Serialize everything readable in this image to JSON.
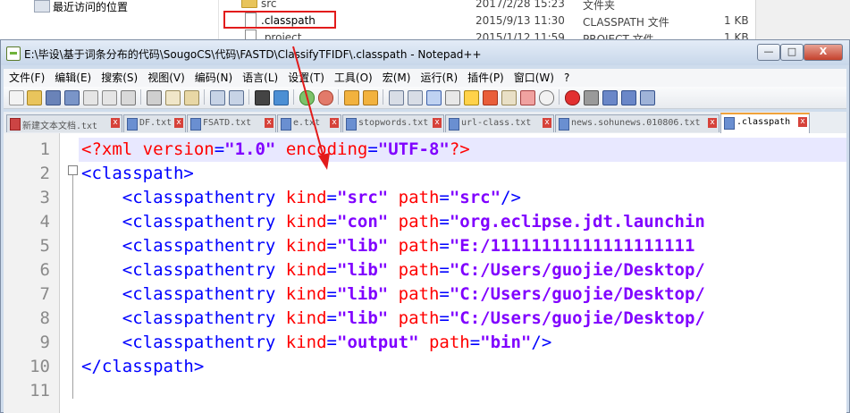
{
  "explorer": {
    "nav_item": "最近访问的位置",
    "rows": [
      {
        "name": "src",
        "date": "2017/2/28 15:23",
        "type": "文件夹",
        "size": ""
      },
      {
        "name": ".classpath",
        "date": "2015/9/13 11:30",
        "type": "CLASSPATH 文件",
        "size": "1 KB"
      },
      {
        "name": ".project",
        "date": "2015/1/12 11:59",
        "type": "PROJECT 文件",
        "size": "1 KB"
      }
    ]
  },
  "window": {
    "title": "E:\\毕设\\基于词条分布的代码\\SougoCS\\代码\\FASTD\\ClassifyTFIDF\\.classpath - Notepad++",
    "btn_min": "—",
    "btn_max": "□",
    "btn_close": "X"
  },
  "menu": [
    "文件(F)",
    "编辑(E)",
    "搜索(S)",
    "视图(V)",
    "编码(N)",
    "语言(L)",
    "设置(T)",
    "工具(O)",
    "宏(M)",
    "运行(R)",
    "插件(P)",
    "窗口(W)",
    "?"
  ],
  "tabs": [
    {
      "label": "新建文本文档.txt"
    },
    {
      "label": "DF.txt"
    },
    {
      "label": "FSATD.txt"
    },
    {
      "label": "e.txt"
    },
    {
      "label": "stopwords.txt"
    },
    {
      "label": "url-class.txt"
    },
    {
      "label": "news.sohunews.010806.txt"
    },
    {
      "label": ".classpath"
    }
  ],
  "editor": {
    "lines": [
      {
        "n": "1",
        "parts": [
          [
            "pi",
            "<?xml "
          ],
          [
            "attr",
            "version"
          ],
          [
            "tag",
            "="
          ],
          [
            "val",
            "\"1.0\""
          ],
          [
            "attr",
            " encoding"
          ],
          [
            "tag",
            "="
          ],
          [
            "val",
            "\"UTF-8\""
          ],
          [
            "pi",
            "?>"
          ]
        ]
      },
      {
        "n": "2",
        "parts": [
          [
            "tag",
            "<classpath>"
          ]
        ]
      },
      {
        "n": "3",
        "parts": [
          [
            "tag",
            "    <classpathentry "
          ],
          [
            "attr",
            "kind"
          ],
          [
            "tag",
            "="
          ],
          [
            "val",
            "\"src\""
          ],
          [
            "attr",
            " path"
          ],
          [
            "tag",
            "="
          ],
          [
            "val",
            "\"src\""
          ],
          [
            "tag",
            "/>"
          ]
        ]
      },
      {
        "n": "4",
        "parts": [
          [
            "tag",
            "    <classpathentry "
          ],
          [
            "attr",
            "kind"
          ],
          [
            "tag",
            "="
          ],
          [
            "val",
            "\"con\""
          ],
          [
            "attr",
            " path"
          ],
          [
            "tag",
            "="
          ],
          [
            "val",
            "\"org.eclipse.jdt.launchin"
          ]
        ]
      },
      {
        "n": "5",
        "parts": [
          [
            "tag",
            "    <classpathentry "
          ],
          [
            "attr",
            "kind"
          ],
          [
            "tag",
            "="
          ],
          [
            "val",
            "\"lib\""
          ],
          [
            "attr",
            " path"
          ],
          [
            "tag",
            "="
          ],
          [
            "val",
            "\"E:/11111111111111111111"
          ]
        ]
      },
      {
        "n": "6",
        "parts": [
          [
            "tag",
            "    <classpathentry "
          ],
          [
            "attr",
            "kind"
          ],
          [
            "tag",
            "="
          ],
          [
            "val",
            "\"lib\""
          ],
          [
            "attr",
            " path"
          ],
          [
            "tag",
            "="
          ],
          [
            "val",
            "\"C:/Users/guojie/Desktop/"
          ]
        ]
      },
      {
        "n": "7",
        "parts": [
          [
            "tag",
            "    <classpathentry "
          ],
          [
            "attr",
            "kind"
          ],
          [
            "tag",
            "="
          ],
          [
            "val",
            "\"lib\""
          ],
          [
            "attr",
            " path"
          ],
          [
            "tag",
            "="
          ],
          [
            "val",
            "\"C:/Users/guojie/Desktop/"
          ]
        ]
      },
      {
        "n": "8",
        "parts": [
          [
            "tag",
            "    <classpathentry "
          ],
          [
            "attr",
            "kind"
          ],
          [
            "tag",
            "="
          ],
          [
            "val",
            "\"lib\""
          ],
          [
            "attr",
            " path"
          ],
          [
            "tag",
            "="
          ],
          [
            "val",
            "\"C:/Users/guojie/Desktop/"
          ]
        ]
      },
      {
        "n": "9",
        "parts": [
          [
            "tag",
            "    <classpathentry "
          ],
          [
            "attr",
            "kind"
          ],
          [
            "tag",
            "="
          ],
          [
            "val",
            "\"output\""
          ],
          [
            "attr",
            " path"
          ],
          [
            "tag",
            "="
          ],
          [
            "val",
            "\"bin\""
          ],
          [
            "tag",
            "/>"
          ]
        ]
      },
      {
        "n": "10",
        "parts": [
          [
            "tag",
            "</classpath>"
          ]
        ]
      },
      {
        "n": "11",
        "parts": []
      }
    ]
  },
  "colors": {
    "tag": "#0000ff",
    "attr": "#ff0000",
    "value": "#8000ff",
    "annotation": "#e21b1b"
  }
}
